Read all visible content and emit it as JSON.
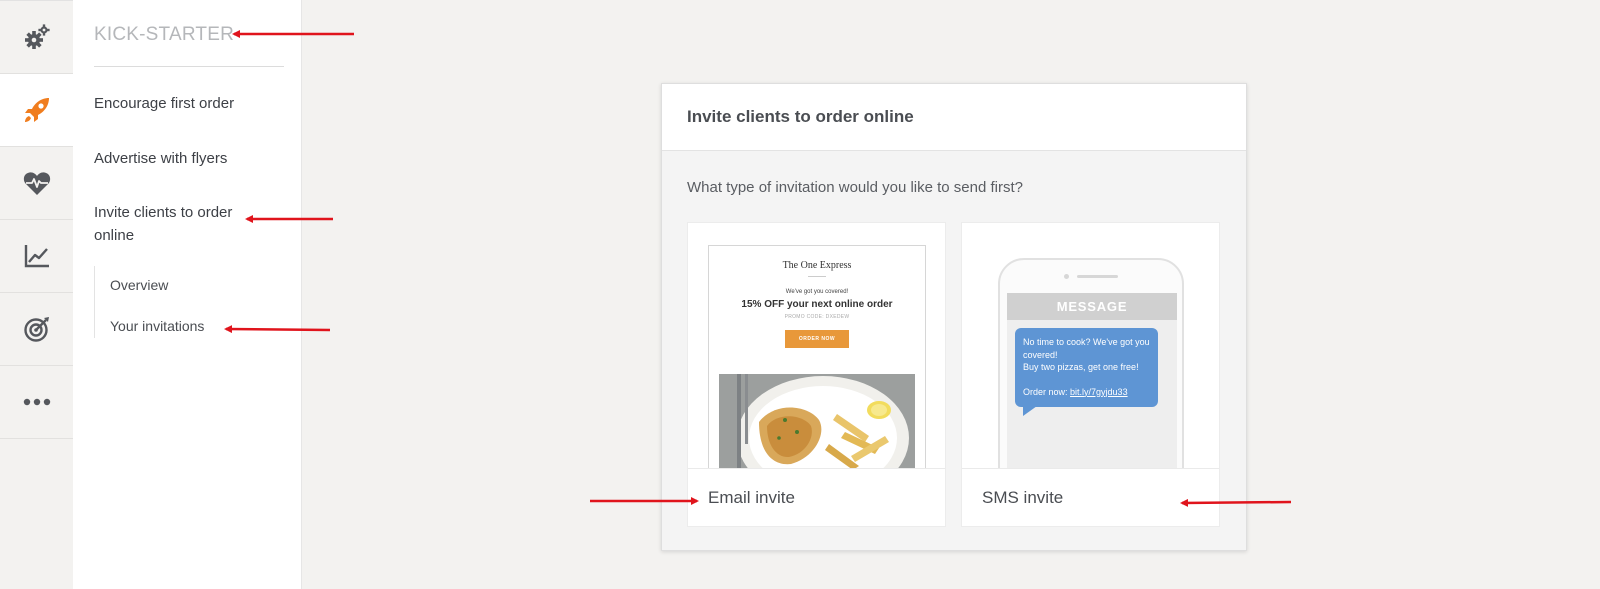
{
  "rail": {
    "items": [
      {
        "icon": "gears-icon",
        "active": false
      },
      {
        "icon": "rocket-icon",
        "active": true
      },
      {
        "icon": "heart-pulse-icon",
        "active": false
      },
      {
        "icon": "line-chart-icon",
        "active": false
      },
      {
        "icon": "target-icon",
        "active": false
      },
      {
        "icon": "more-icon",
        "active": false
      }
    ],
    "accent_color": "#f07d1e"
  },
  "subnav": {
    "title": "KICK-STARTER",
    "items": [
      {
        "label": "Encourage first order"
      },
      {
        "label": "Advertise with flyers"
      },
      {
        "label": "Invite clients to order online"
      }
    ],
    "subitems": [
      {
        "label": "Overview"
      },
      {
        "label": "Your invitations"
      }
    ]
  },
  "card": {
    "title": "Invite clients to order online",
    "question": "What type of invitation would you like to send first?",
    "options": [
      {
        "label": "Email invite",
        "preview": {
          "brand": "The One Express",
          "tagline": "We've got you covered!",
          "offer": "15% OFF your next online order",
          "promo": "PROMO CODE: DXEDEW",
          "button": "ORDER NOW"
        }
      },
      {
        "label": "SMS invite",
        "preview": {
          "header": "MESSAGE",
          "line1": "No time to cook? We've got you covered!",
          "line2": "Buy two pizzas, get one free!",
          "line3_prefix": "Order now: ",
          "link": "bit.ly/7gyjdu33"
        }
      }
    ]
  },
  "annotation_color": "#e0141c"
}
